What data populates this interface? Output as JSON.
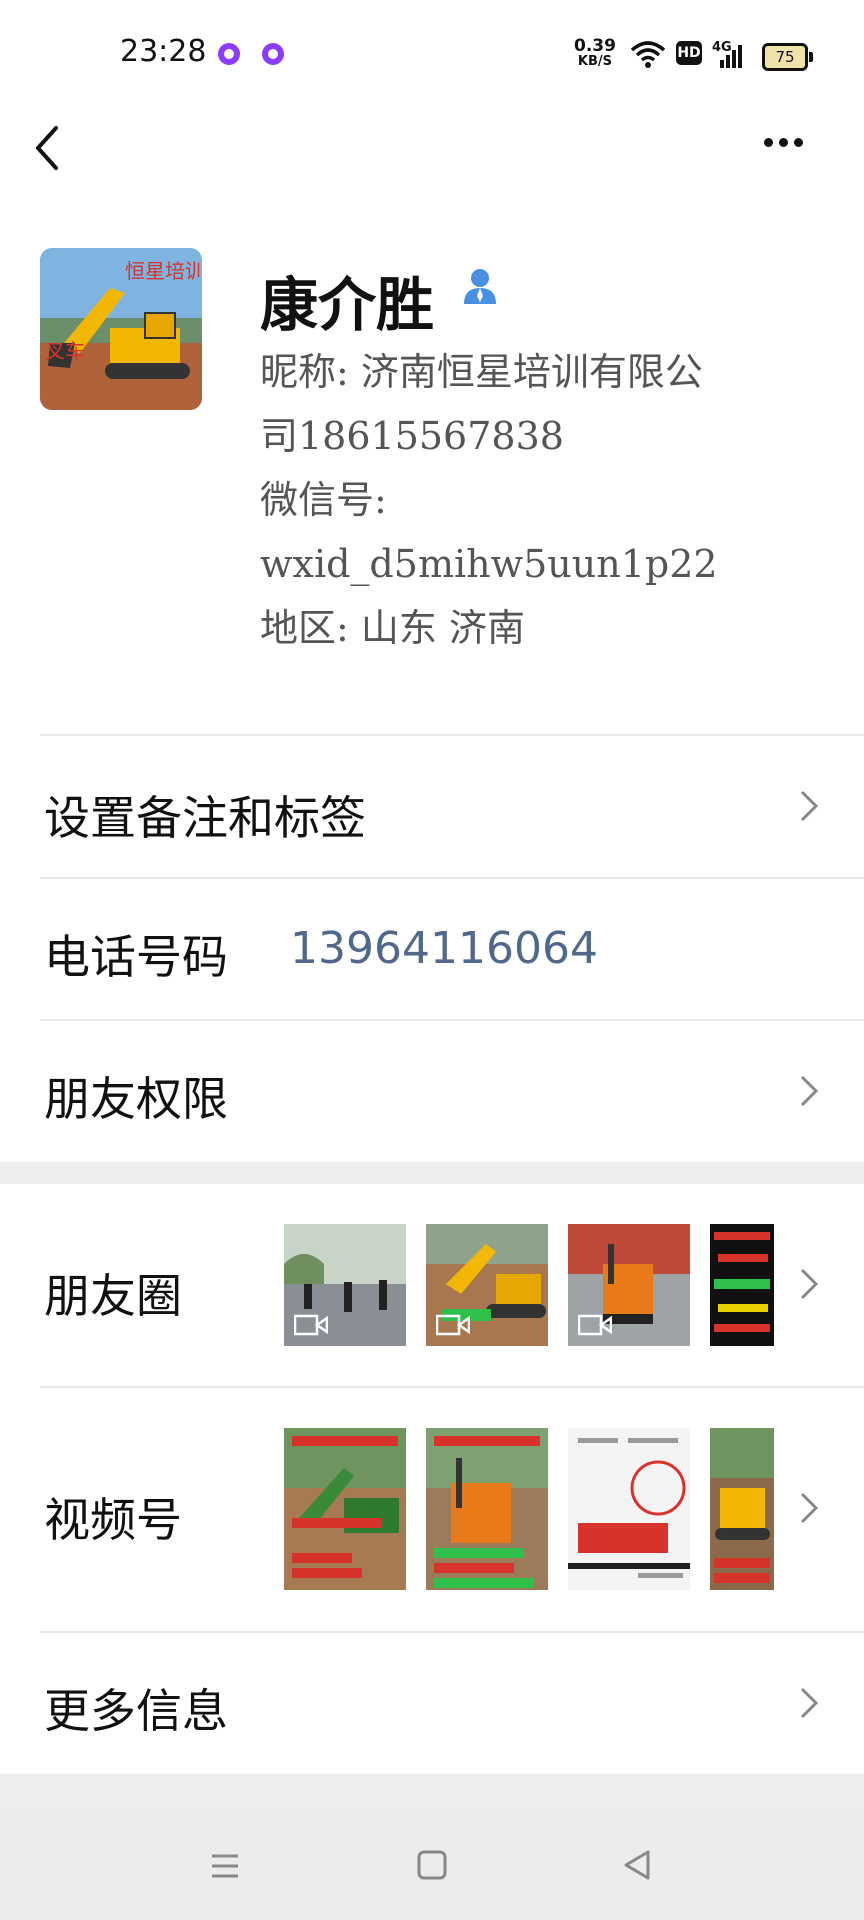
{
  "status_bar": {
    "time": "23:28",
    "speed_value": "0.39",
    "speed_unit": "KB/S",
    "hd_badge": "HD",
    "network": "4G",
    "battery": "75"
  },
  "profile": {
    "name": "康介胜",
    "nickname_line1": "昵称: 济南恒星培训有限公",
    "nickname_line2": "司18615567838",
    "wechat_label": "微信号:",
    "wechat_id": "wxid_d5mihw5uun1p22",
    "region": "地区: 山东  济南"
  },
  "rows": {
    "remark": "设置备注和标签",
    "phone_label": "电话号码",
    "phone_value": "13964116064",
    "permissions": "朋友权限",
    "moments": "朋友圈",
    "channels": "视频号",
    "more_info": "更多信息"
  },
  "colors": {
    "accent_link": "#50688c",
    "divider": "#e8e8e8",
    "section_gap": "#ededed",
    "contact_icon": "#4a90e2"
  },
  "icons": [
    "back-icon",
    "more-icon",
    "contact-icon",
    "chevron-right-icon",
    "video-icon",
    "menu-icon",
    "home-icon",
    "back-triangle-icon"
  ]
}
